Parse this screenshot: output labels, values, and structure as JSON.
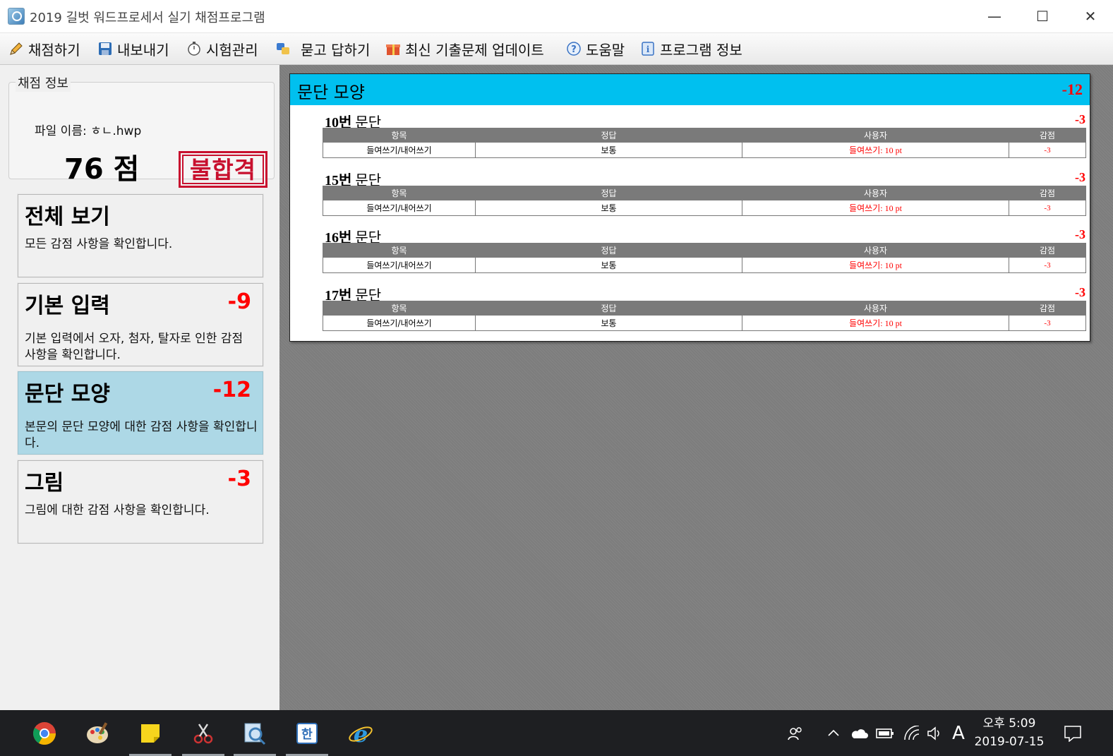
{
  "window": {
    "title": "2019 길벗 워드프로세서 실기 채점프로그램",
    "minimize": "—",
    "maximize": "☐",
    "close": "✕"
  },
  "menu": [
    {
      "label": "채점하기",
      "icon": "pencil-icon"
    },
    {
      "label": "내보내기",
      "icon": "save-icon"
    },
    {
      "label": "시험관리",
      "icon": "stopwatch-icon"
    },
    {
      "label": "묻고 답하기",
      "icon": "qa-icon"
    },
    {
      "label": "최신 기출문제 업데이트",
      "icon": "gift-icon"
    },
    {
      "label": "도움말",
      "icon": "help-icon"
    },
    {
      "label": "프로그램 정보",
      "icon": "info-icon"
    }
  ],
  "info": {
    "legend": "채점 정보",
    "file_label": "파일 이름: ㅎㄴ.hwp",
    "score": "76 점",
    "result_stamp": "불합격"
  },
  "cards": [
    {
      "title": "전체 보기",
      "deduction": "",
      "desc": "모든 감점 사항을 확인합니다."
    },
    {
      "title": "기본 입력",
      "deduction": "-9",
      "desc": "기본 입력에서 오자, 첨자, 탈자로 인한 감점 사항을 확인합니다."
    },
    {
      "title": "문단 모양",
      "deduction": "-12",
      "desc": "본문의 문단 모양에 대한 감점 사항을 확인합니다."
    },
    {
      "title": "그림",
      "deduction": "-3",
      "desc": "그림에 대한 감점 사항을 확인합니다."
    }
  ],
  "report": {
    "title": "문단 모양",
    "deduction": "-12",
    "columns": [
      "항목",
      "정답",
      "사용자",
      "감점"
    ],
    "sections": [
      {
        "num": "10번",
        "title": " 문단",
        "deduction": "-3",
        "row": {
          "item": "들여쓰기/내어쓰기",
          "answer": "보통",
          "user": "들여쓰기: 10 pt",
          "deduct": "-3"
        }
      },
      {
        "num": "15번",
        "title": " 문단",
        "deduction": "-3",
        "row": {
          "item": "들여쓰기/내어쓰기",
          "answer": "보통",
          "user": "들여쓰기: 10 pt",
          "deduct": "-3"
        }
      },
      {
        "num": "16번",
        "title": " 문단",
        "deduction": "-3",
        "row": {
          "item": "들여쓰기/내어쓰기",
          "answer": "보통",
          "user": "들여쓰기: 10 pt",
          "deduct": "-3"
        }
      },
      {
        "num": "17번",
        "title": " 문단",
        "deduction": "-3",
        "row": {
          "item": "들여쓰기/내어쓰기",
          "answer": "보통",
          "user": "들여쓰기: 10 pt",
          "deduct": "-3"
        }
      }
    ]
  },
  "taskbar": {
    "apps": [
      "chrome-icon",
      "paint-icon",
      "sticky-notes-icon",
      "snipping-tool-icon",
      "grading-program-icon",
      "hwp-icon",
      "internet-explorer-icon"
    ],
    "ime": "A",
    "time": "오후 5:09",
    "date": "2019-07-15"
  },
  "colors": {
    "report_header": "#00c0ef",
    "selected_card": "#add8e6",
    "deduction": "#ff0000",
    "stamp": "#c8102e"
  }
}
